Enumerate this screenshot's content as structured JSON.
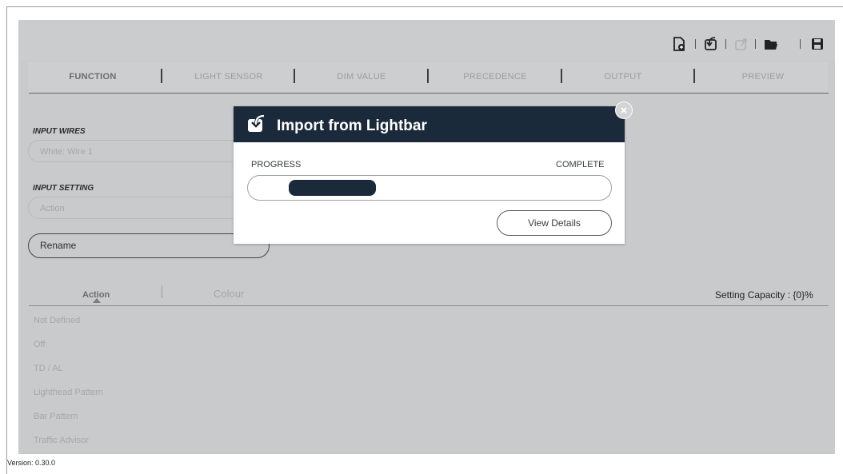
{
  "toolbar": {
    "icons": [
      "new-file-icon",
      "import-icon",
      "export-icon",
      "open-folder-icon",
      "save-icon"
    ]
  },
  "tabs": [
    {
      "label": "FUNCTION",
      "active": true
    },
    {
      "label": "LIGHT SENSOR",
      "active": false
    },
    {
      "label": "DIM VALUE",
      "active": false
    },
    {
      "label": "PRECEDENCE",
      "active": false
    },
    {
      "label": "OUTPUT",
      "active": false
    },
    {
      "label": "PREVIEW",
      "active": false
    }
  ],
  "form": {
    "input_wires_label": "INPUT WIRES",
    "input_wires_value": "White:  Wire 1",
    "input_setting_label": "INPUT SETTING",
    "input_setting_value": "Action",
    "rename_button": "Rename"
  },
  "subtabs": {
    "action": "Action",
    "colour": "Colour"
  },
  "capacity": "Setting Capacity  : {0}%",
  "actions_list": [
    "Not Defined",
    "Off",
    "TD / AL",
    "Lighthead Pattern",
    "Bar Pattern",
    "Traffic Advisor"
  ],
  "version": "Version: 0.30.0",
  "modal": {
    "title": "Import from Lightbar",
    "progress_label": "PROGRESS",
    "complete_label": "COMPLETE",
    "progress_fraction": 0.24,
    "view_details": "View Details"
  },
  "colors": {
    "header_navy": "#1a2a3a",
    "app_bg": "#c9cacb"
  }
}
